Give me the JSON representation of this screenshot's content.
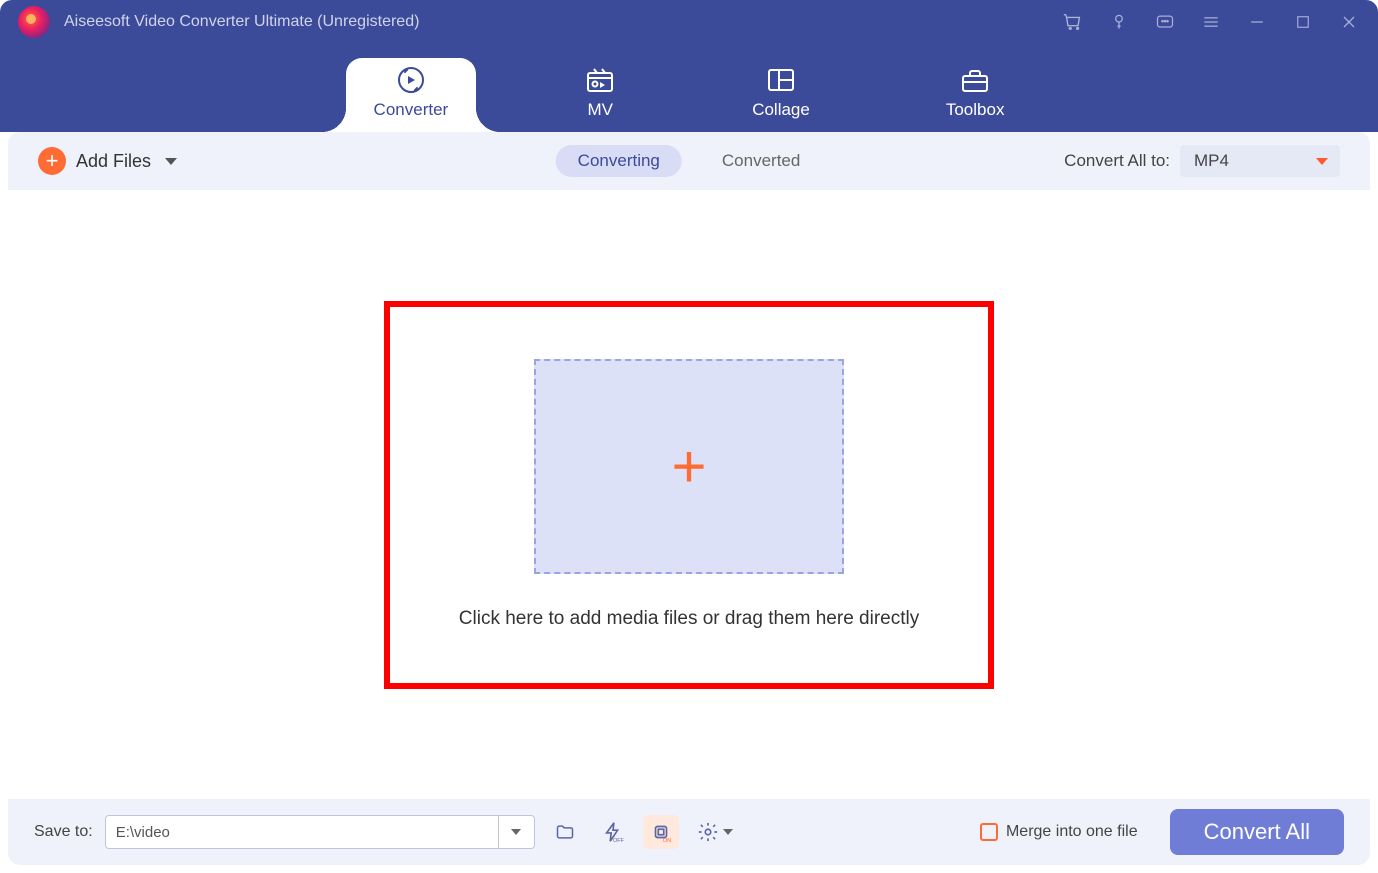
{
  "app": {
    "title": "Aiseesoft Video Converter Ultimate (Unregistered)"
  },
  "nav": {
    "tabs": [
      {
        "label": "Converter",
        "active": true,
        "icon": "converter-icon"
      },
      {
        "label": "MV",
        "active": false,
        "icon": "mv-icon"
      },
      {
        "label": "Collage",
        "active": false,
        "icon": "collage-icon"
      },
      {
        "label": "Toolbox",
        "active": false,
        "icon": "toolbox-icon"
      }
    ]
  },
  "toolbar": {
    "add_files_label": "Add Files",
    "status_tabs": [
      {
        "label": "Converting",
        "active": true
      },
      {
        "label": "Converted",
        "active": false
      }
    ],
    "convert_all_to_label": "Convert All to:",
    "format_selected": "MP4"
  },
  "dropzone": {
    "hint": "Click here to add media files or drag them here directly"
  },
  "footer": {
    "save_to_label": "Save to:",
    "save_path": "E:\\video",
    "merge_label": "Merge into one file",
    "convert_button": "Convert All"
  }
}
